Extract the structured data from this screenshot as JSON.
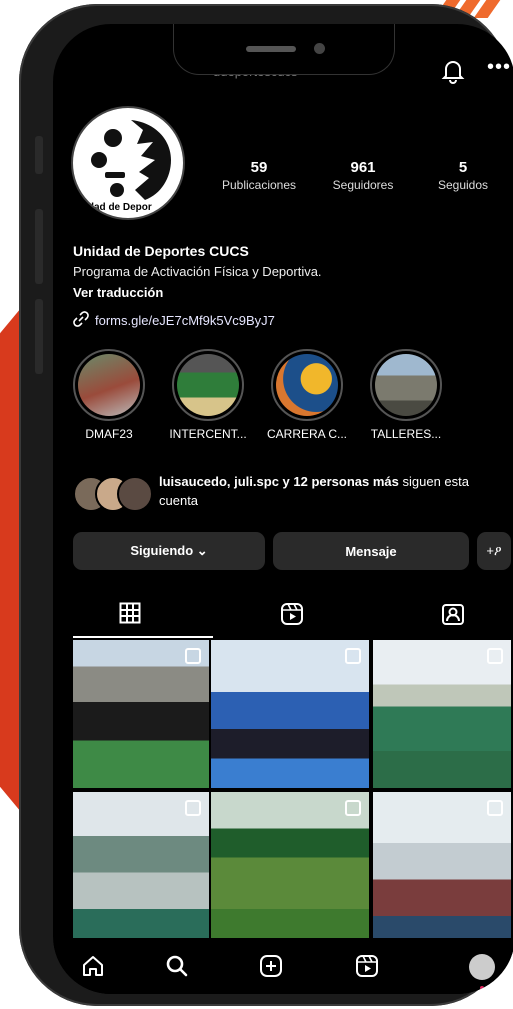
{
  "profile": {
    "username": "udeportescucs",
    "avatar_text": "nidad de Depor",
    "name": "Unidad de Deportes CUCS",
    "bio": "Programa de Activación Física y Deportiva.",
    "translate": "Ver traducción",
    "link": "forms.gle/eJE7cMf9k5Vc9ByJ7"
  },
  "stats": [
    {
      "value": "59",
      "label": "Publicaciones"
    },
    {
      "value": "961",
      "label": "Seguidores"
    },
    {
      "value": "5",
      "label": "Seguidos"
    }
  ],
  "highlights": [
    {
      "label": "DMAF23"
    },
    {
      "label": "INTERCENT..."
    },
    {
      "label": "CARRERA C..."
    },
    {
      "label": "TALLERES..."
    }
  ],
  "followed_by": {
    "names": "luisaucedo, juli.spc y 12 personas más",
    "suffix": " siguen esta cuenta"
  },
  "actions": {
    "following": "Siguiendo ⌄",
    "message": "Mensaje",
    "add_user": "+ዖ"
  },
  "icons": {
    "bell": "bell-icon",
    "more": "more-icon",
    "link": "link-icon",
    "grid": "grid-icon",
    "reels": "reels-icon",
    "tagged": "tagged-icon",
    "home": "home-icon",
    "search": "search-icon",
    "create": "create-icon",
    "reels_nav": "reels-nav-icon"
  },
  "colors": {
    "background": "#000000",
    "button": "#2a2a2a",
    "accent_red": "#d83a1d",
    "accent_orange": "#ef6a2d"
  }
}
